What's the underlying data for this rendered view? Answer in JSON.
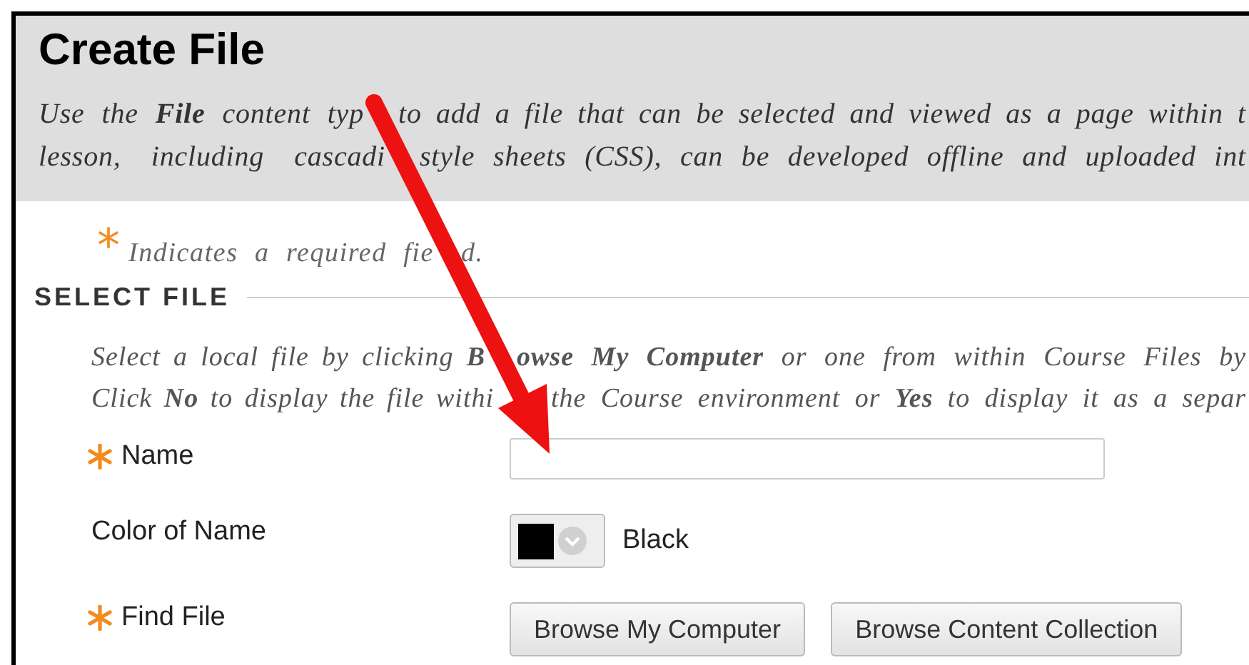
{
  "header": {
    "title": "Create File",
    "description": [
      [
        "Use the **File** content typ",
        "to add a file that can be selected and viewed as a page within t"
      ],
      [
        "lesson, including cascadi",
        "style sheets (CSS), can be developed offline and uploaded int"
      ]
    ]
  },
  "required_note": {
    "marker": "*",
    "text": [
      "Indicates a required fie",
      "d."
    ]
  },
  "section": {
    "title": "SELECT FILE",
    "instructions": [
      [
        "Select a local file by clicking **B**",
        "**owse My Computer** or one from within Course Files by"
      ],
      [
        "Click **No** to display the file withi",
        "the Course environment or **Yes** to display it as a separ"
      ]
    ]
  },
  "fields": [
    {
      "kind": "text",
      "label": "Name",
      "required": true
    },
    {
      "kind": "color",
      "label": "Color of Name",
      "required": false,
      "color": "#000000",
      "value": "Black"
    },
    {
      "kind": "buttons",
      "label": "Find File",
      "required": true,
      "buttons": [
        "Browse My Computer",
        "Browse Content Collection"
      ]
    }
  ]
}
